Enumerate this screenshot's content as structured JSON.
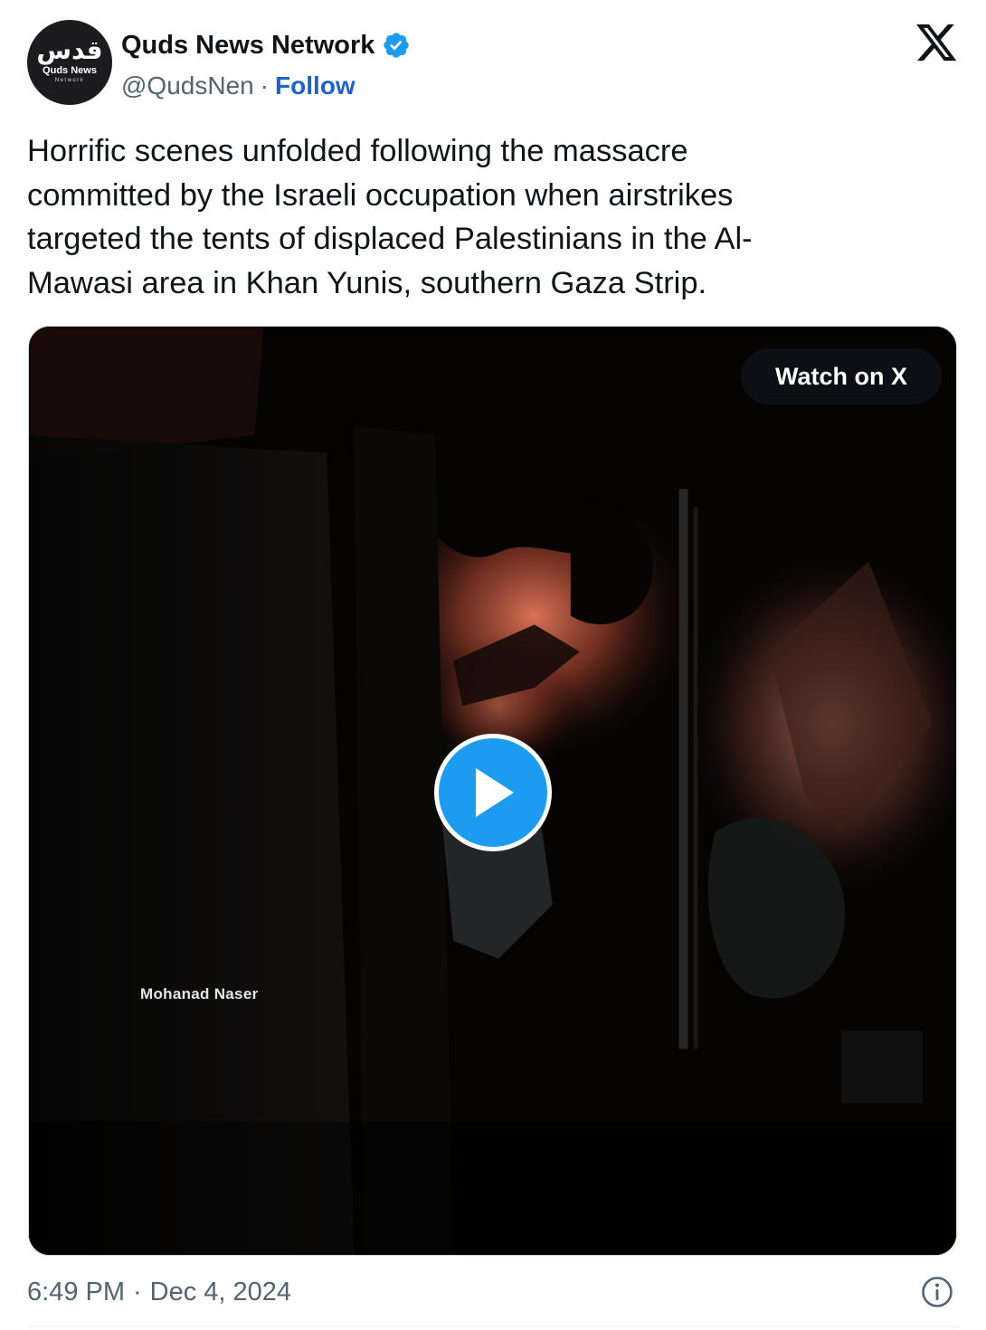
{
  "tweet": {
    "author": {
      "name": "Quds News Network",
      "handle": "@QudsNen",
      "separator": "·",
      "follow_label": "Follow",
      "avatar": {
        "glyph": "قدس",
        "line1": "Quds News",
        "line2": "Network"
      }
    },
    "text": "Horrific scenes unfolded following the massacre\ncommitted by the Israeli occupation when airstrikes\ntargeted the tents of displaced Palestinians in the Al-\nMawasi area in Khan Yunis, southern Gaza Strip.",
    "media": {
      "watch_label": "Watch on X",
      "watermark": "Mohanad Naser"
    },
    "time": "6:49 PM",
    "separator": "·",
    "date": "Dec 4, 2024"
  },
  "icons": {
    "verified": "verified-badge-icon",
    "platform": "x-logo-icon",
    "play": "play-icon",
    "info": "info-icon"
  },
  "colors": {
    "text": "#0f1419",
    "secondary": "#536471",
    "link": "#1d63c9",
    "verified": "#1d9bf0",
    "play": "#1d9bf0"
  }
}
